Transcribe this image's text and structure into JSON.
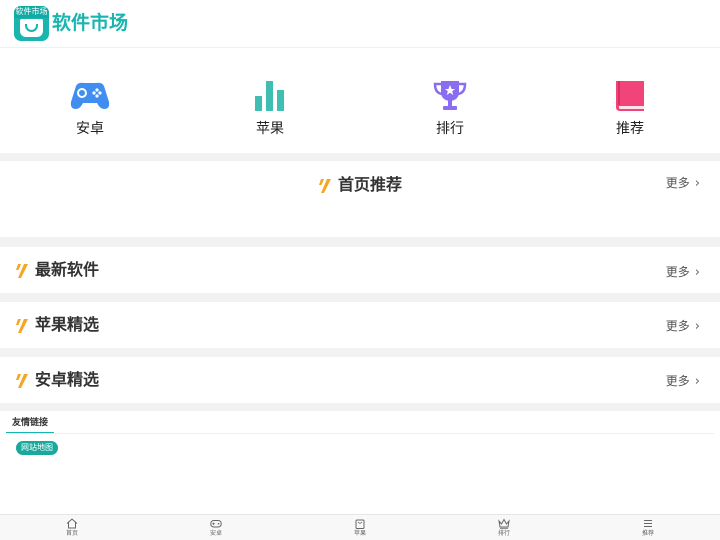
{
  "header": {
    "logo_text": "软件市场",
    "site_title": "软件市场"
  },
  "categories": [
    {
      "label": "安卓",
      "icon": "gamepad-icon",
      "color": "#3f8ef0"
    },
    {
      "label": "苹果",
      "icon": "bar-chart-icon",
      "color": "#3fbfb1"
    },
    {
      "label": "排行",
      "icon": "trophy-icon",
      "color": "#8a6df0"
    },
    {
      "label": "推荐",
      "icon": "book-icon",
      "color": "#f0447a"
    }
  ],
  "sections": [
    {
      "title": "首页推荐",
      "more": "更多"
    },
    {
      "title": "最新软件",
      "more": "更多"
    },
    {
      "title": "苹果精选",
      "more": "更多"
    },
    {
      "title": "安卓精选",
      "more": "更多"
    }
  ],
  "friend_links": {
    "title": "友情链接",
    "items": [
      "网站地图"
    ]
  },
  "tabbar": [
    {
      "label": "首页",
      "icon": "home-icon"
    },
    {
      "label": "安卓",
      "icon": "gamepad-icon"
    },
    {
      "label": "苹果",
      "icon": "bag-icon"
    },
    {
      "label": "排行",
      "icon": "crown-icon"
    },
    {
      "label": "推荐",
      "icon": "list-icon"
    }
  ],
  "colors": {
    "brand": "#19b5b0",
    "accent_slash": "#f5a623",
    "tag_bg": "#19a99c"
  }
}
